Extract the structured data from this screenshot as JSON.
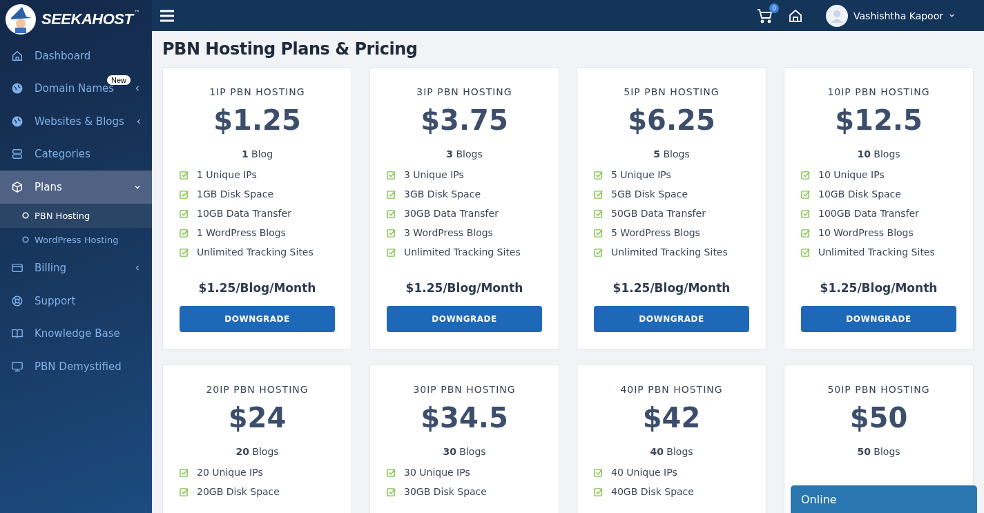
{
  "brand": {
    "name": "SEEKAHOST",
    "mark": "™"
  },
  "sidebar": {
    "items": [
      {
        "label": "Dashboard",
        "selected": false
      },
      {
        "label": "Domain Names",
        "badge": "New",
        "selected": false,
        "expanded": false
      },
      {
        "label": "Websites & Blogs",
        "selected": false,
        "expanded": false
      },
      {
        "label": "Categories",
        "selected": false
      },
      {
        "label": "Plans",
        "selected": true,
        "expanded": true,
        "children": [
          {
            "label": "PBN Hosting",
            "selected": true
          },
          {
            "label": "WordPress Hosting",
            "selected": false
          }
        ]
      },
      {
        "label": "Billing",
        "selected": false,
        "expanded": false
      },
      {
        "label": "Support",
        "selected": false
      },
      {
        "label": "Knowledge Base",
        "selected": false
      },
      {
        "label": "PBN Demystified",
        "selected": false
      }
    ]
  },
  "topbar": {
    "cart_count": "0",
    "user": "Vashishtha Kapoor"
  },
  "page_title": "PBN Hosting Plans & Pricing",
  "plans": [
    {
      "title": "1IP PBN HOSTING",
      "price": "$1.25",
      "blogs": "**1** Blog",
      "features": [
        "1 Unique IPs",
        "1GB Disk Space",
        "10GB Data Transfer",
        "1 WordPress Blogs",
        "Unlimited Tracking Sites"
      ],
      "per_blog": "$1.25/Blog/Month",
      "button": "DOWNGRADE"
    },
    {
      "title": "3IP PBN HOSTING",
      "price": "$3.75",
      "blogs": "**3** Blogs",
      "features": [
        "3 Unique IPs",
        "3GB Disk Space",
        "30GB Data Transfer",
        "3 WordPress Blogs",
        "Unlimited Tracking Sites"
      ],
      "per_blog": "$1.25/Blog/Month",
      "button": "DOWNGRADE"
    },
    {
      "title": "5IP PBN HOSTING",
      "price": "$6.25",
      "blogs": "**5** Blogs",
      "features": [
        "5 Unique IPs",
        "5GB Disk Space",
        "50GB Data Transfer",
        "5 WordPress Blogs",
        "Unlimited Tracking Sites"
      ],
      "per_blog": "$1.25/Blog/Month",
      "button": "DOWNGRADE"
    },
    {
      "title": "10IP PBN HOSTING",
      "price": "$12.5",
      "blogs": "**10** Blogs",
      "features": [
        "10 Unique IPs",
        "10GB Disk Space",
        "100GB Data Transfer",
        "10 WordPress Blogs",
        "Unlimited Tracking Sites"
      ],
      "per_blog": "$1.25/Blog/Month",
      "button": "DOWNGRADE"
    },
    {
      "title": "20IP PBN HOSTING",
      "price": "$24",
      "blogs": "**20** Blogs",
      "features": [
        "20 Unique IPs",
        "20GB Disk Space"
      ]
    },
    {
      "title": "30IP PBN HOSTING",
      "price": "$34.5",
      "blogs": "**30** Blogs",
      "features": [
        "30 Unique IPs",
        "30GB Disk Space"
      ]
    },
    {
      "title": "40IP PBN HOSTING",
      "price": "$42",
      "blogs": "**40** Blogs",
      "features": [
        "40 Unique IPs",
        "40GB Disk Space"
      ]
    },
    {
      "title": "50IP PBN HOSTING",
      "price": "$50",
      "blogs": "**50** Blogs"
    }
  ],
  "chat": {
    "status": "Online"
  }
}
